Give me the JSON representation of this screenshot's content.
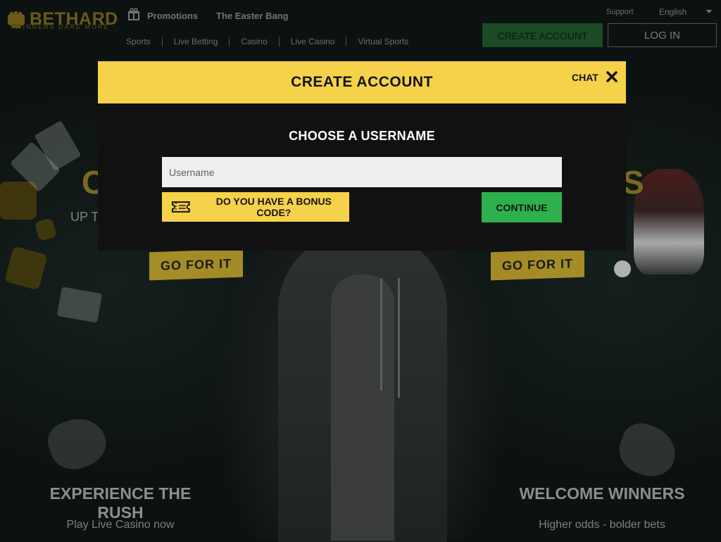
{
  "header": {
    "brand": "BETHARD",
    "tagline": "WINNERS DARE MORE",
    "top_nav": [
      "Promotions",
      "The Easter Bang"
    ],
    "sub_nav": [
      "Sports",
      "Live Betting",
      "Casino",
      "Live Casino",
      "Virtual Sports"
    ],
    "support": "Support",
    "language": "English",
    "create_account": "CREATE ACCOUNT",
    "login": "LOG IN"
  },
  "background": {
    "promo_sub": "UP TO",
    "go_left": "GO FOR IT",
    "go_right": "GO FOR IT",
    "hero_left_title": "EXPERIENCE THE RUSH",
    "hero_left_sub": "Play Live Casino now",
    "hero_right_title": "WELCOME WINNERS",
    "hero_right_sub": "Higher odds - bolder bets"
  },
  "modal": {
    "title": "CREATE ACCOUNT",
    "chat": "CHAT",
    "subtitle": "CHOOSE A USERNAME",
    "username_placeholder": "Username",
    "username_value": "",
    "bonus_label": "DO YOU HAVE A BONUS CODE?",
    "continue_label": "CONTINUE"
  },
  "icons": {
    "logo": "fist-icon",
    "promotions": "gift-icon",
    "close": "close-icon",
    "bonus": "ticket-icon",
    "language": "chevron-down-icon"
  },
  "colors": {
    "accent_yellow": "#f6d24a",
    "continue_green": "#2fb04f",
    "modal_bg": "#111111",
    "brand_gold": "#6b5a17"
  }
}
